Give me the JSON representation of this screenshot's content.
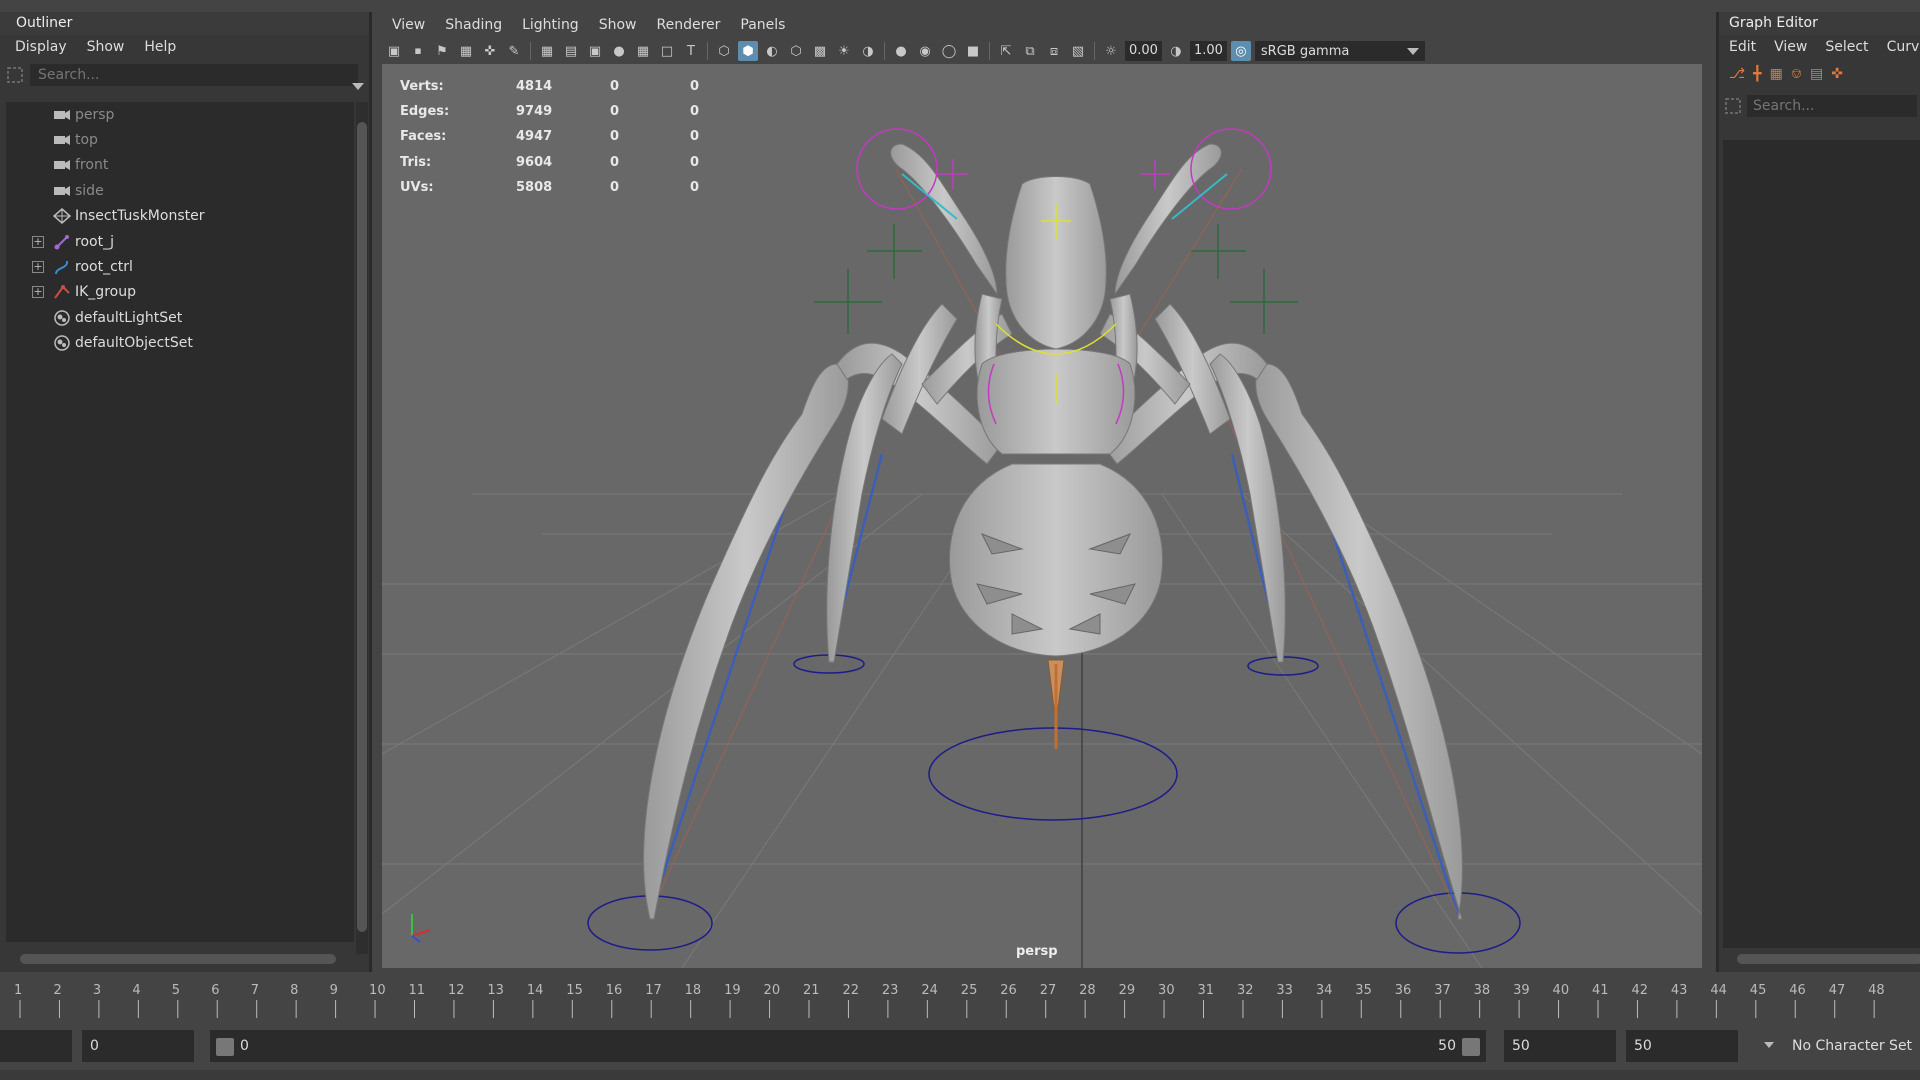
{
  "outliner": {
    "title": "Outliner",
    "menu": [
      "Display",
      "Show",
      "Help"
    ],
    "search_placeholder": "Search...",
    "items": [
      {
        "label": "persp",
        "icon": "camera-icon",
        "dim": true,
        "expandable": false
      },
      {
        "label": "top",
        "icon": "camera-icon",
        "dim": true,
        "expandable": false
      },
      {
        "label": "front",
        "icon": "camera-icon",
        "dim": true,
        "expandable": false
      },
      {
        "label": "side",
        "icon": "camera-icon",
        "dim": true,
        "expandable": false
      },
      {
        "label": "InsectTuskMonster",
        "icon": "mesh-icon",
        "dim": false,
        "expandable": false
      },
      {
        "label": "root_j",
        "icon": "joint-icon",
        "dim": false,
        "expandable": true
      },
      {
        "label": "root_ctrl",
        "icon": "curve-icon",
        "dim": false,
        "expandable": true
      },
      {
        "label": "IK_group",
        "icon": "ik-icon",
        "dim": false,
        "expandable": true
      },
      {
        "label": "defaultLightSet",
        "icon": "set-icon",
        "dim": false,
        "expandable": false
      },
      {
        "label": "defaultObjectSet",
        "icon": "set-icon",
        "dim": false,
        "expandable": false
      }
    ]
  },
  "viewport": {
    "menu": [
      "View",
      "Shading",
      "Lighting",
      "Show",
      "Renderer",
      "Panels"
    ],
    "toolbar": {
      "exposure_value": "0.00",
      "gamma_value": "1.00",
      "color_space": "sRGB gamma"
    },
    "stats": [
      {
        "label": "Verts:",
        "v1": "4814",
        "v2": "0",
        "v3": "0"
      },
      {
        "label": "Edges:",
        "v1": "9749",
        "v2": "0",
        "v3": "0"
      },
      {
        "label": "Faces:",
        "v1": "4947",
        "v2": "0",
        "v3": "0"
      },
      {
        "label": "Tris:",
        "v1": "9604",
        "v2": "0",
        "v3": "0"
      },
      {
        "label": "UVs:",
        "v1": "5808",
        "v2": "0",
        "v3": "0"
      }
    ],
    "camera_label": "persp"
  },
  "graph_editor": {
    "title": "Graph Editor",
    "menu": [
      "Edit",
      "View",
      "Select",
      "Curves"
    ],
    "search_placeholder": "Search..."
  },
  "timeline": {
    "ticks": [
      "1",
      "2",
      "3",
      "4",
      "5",
      "6",
      "7",
      "8",
      "9",
      "10",
      "11",
      "12",
      "13",
      "14",
      "15",
      "16",
      "17",
      "18",
      "19",
      "20",
      "21",
      "22",
      "23",
      "24",
      "25",
      "26",
      "27",
      "28",
      "29",
      "30",
      "31",
      "32",
      "33",
      "34",
      "35",
      "36",
      "37",
      "38",
      "39",
      "40",
      "41",
      "42",
      "43",
      "44",
      "45",
      "46",
      "47",
      "48"
    ]
  },
  "range": {
    "start_field": "0",
    "slider_start": "0",
    "slider_end": "50",
    "end_field": "50",
    "anim_end_field": "50",
    "character_set": "No Character Set"
  },
  "colors": {
    "accent": "#5f8dad",
    "control_magenta": "#c23ac2",
    "control_navy": "#1c1c8a",
    "locator_green": "#2f6b3a"
  }
}
